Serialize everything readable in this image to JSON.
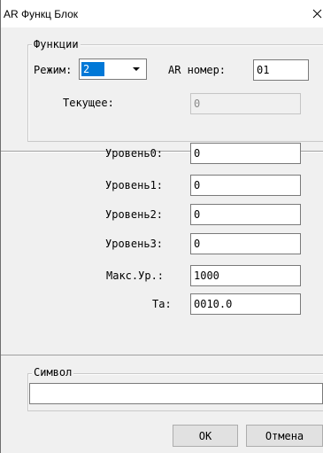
{
  "window": {
    "title": "AR Функц Блок"
  },
  "functions_group": {
    "legend": "Функции",
    "mode_label": "Режим:",
    "mode_value": "2",
    "ar_number_label": "AR номер:",
    "ar_number_value": "01",
    "current_label": "Текущее:",
    "current_value": "0"
  },
  "levels": {
    "level0_label": "Уровень0:",
    "level0_value": "0",
    "level1_label": "Уровень1:",
    "level1_value": "0",
    "level2_label": "Уровень2:",
    "level2_value": "0",
    "level3_label": "Уровень3:",
    "level3_value": "0",
    "max_level_label": "Макс.Ур.:",
    "max_level_value": "1000",
    "ta_label": "Ta:",
    "ta_value": "0010.0"
  },
  "symbol_group": {
    "legend": "Символ",
    "value": ""
  },
  "buttons": {
    "ok_label": "OK",
    "cancel_label": "Отмена"
  },
  "icons": {
    "close": "close-icon",
    "dropdown": "chevron-down-icon"
  },
  "colors": {
    "selection": "#0078d7",
    "window_bg": "#f0f0f0"
  }
}
